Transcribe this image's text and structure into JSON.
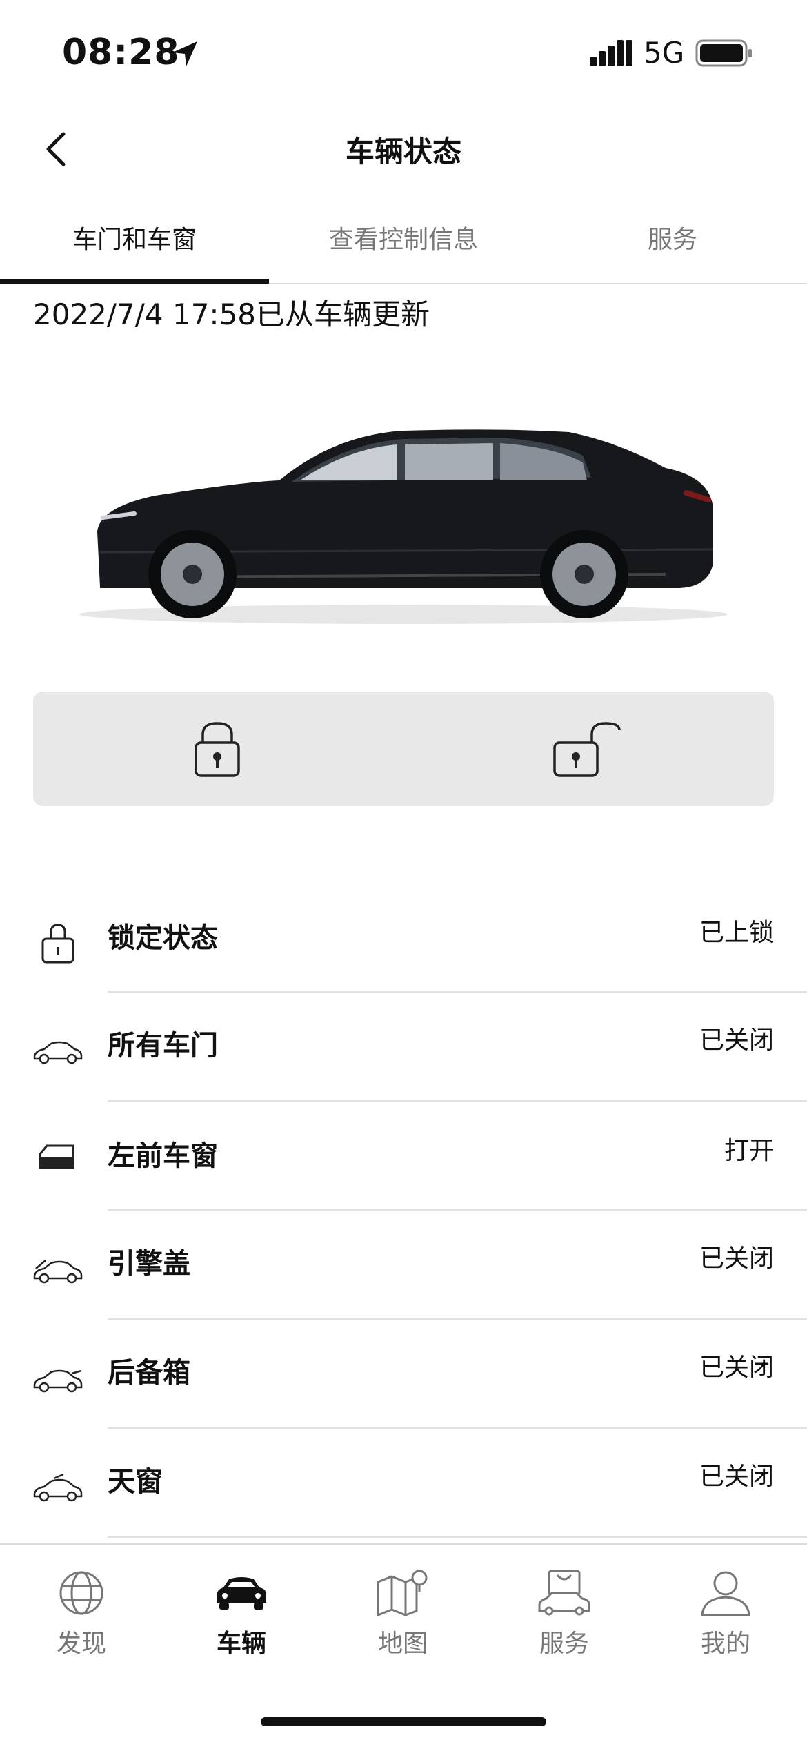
{
  "status_bar": {
    "time": "08:28",
    "network": "5G"
  },
  "header": {
    "title": "车辆状态"
  },
  "tabs": [
    {
      "label": "车门和车窗",
      "active": true
    },
    {
      "label": "查看控制信息",
      "active": false
    },
    {
      "label": "服务",
      "active": false
    }
  ],
  "update_time": "2022/7/4 17:58已从车辆更新",
  "status_items": [
    {
      "icon": "lock-icon",
      "label": "锁定状态",
      "value": "已上锁"
    },
    {
      "icon": "car-doors-icon",
      "label": "所有车门",
      "value": "已关闭"
    },
    {
      "icon": "window-icon",
      "label": "左前车窗",
      "value": "打开"
    },
    {
      "icon": "hood-icon",
      "label": "引擎盖",
      "value": "已关闭"
    },
    {
      "icon": "trunk-icon",
      "label": "后备箱",
      "value": "已关闭"
    },
    {
      "icon": "sunroof-icon",
      "label": "天窗",
      "value": "已关闭"
    }
  ],
  "bottom_nav": [
    {
      "icon": "globe-icon",
      "label": "发现",
      "active": false
    },
    {
      "icon": "car-icon",
      "label": "车辆",
      "active": true
    },
    {
      "icon": "map-icon",
      "label": "地图",
      "active": false
    },
    {
      "icon": "service-icon",
      "label": "服务",
      "active": false
    },
    {
      "icon": "profile-icon",
      "label": "我的",
      "active": false
    }
  ],
  "colors": {
    "accent": "#111111",
    "inactive": "#777777",
    "panel": "#e8e8e8"
  }
}
